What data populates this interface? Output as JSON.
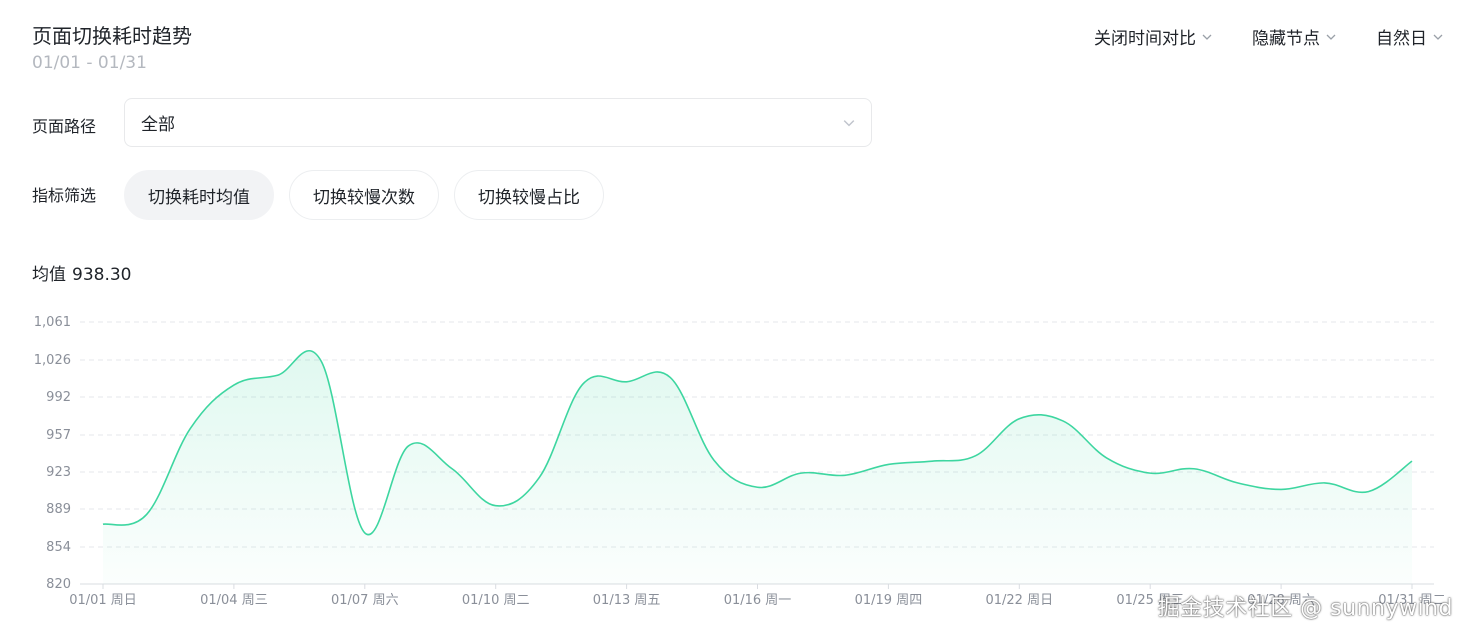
{
  "header": {
    "title": "页面切换耗时趋势",
    "date_range": "01/01 - 01/31",
    "controls": [
      {
        "label": "关闭时间对比"
      },
      {
        "label": "隐藏节点"
      },
      {
        "label": "自然日"
      }
    ]
  },
  "path": {
    "label": "页面路径",
    "value": "全部"
  },
  "metric": {
    "label": "指标筛选",
    "options": [
      {
        "label": "切换耗时均值",
        "active": true
      },
      {
        "label": "切换较慢次数",
        "active": false
      },
      {
        "label": "切换较慢占比",
        "active": false
      }
    ]
  },
  "summary": {
    "label": "均值",
    "value": "938.30"
  },
  "watermark": "掘金技术社区 @ sunnywind",
  "colors": {
    "line": "#3dd6a0",
    "grid": "#e5e7eb"
  },
  "chart_data": {
    "type": "area",
    "ylim": [
      820,
      1061
    ],
    "yticks": [
      "1,061",
      "1,026",
      "992",
      "957",
      "923",
      "889",
      "854",
      "820"
    ],
    "ytick_values": [
      1061,
      1026,
      992,
      957,
      923,
      889,
      854,
      820
    ],
    "xtick_labels": [
      {
        "day": 1,
        "label": "01/01 周日"
      },
      {
        "day": 4,
        "label": "01/04 周三"
      },
      {
        "day": 7,
        "label": "01/07 周六"
      },
      {
        "day": 10,
        "label": "01/10 周二"
      },
      {
        "day": 13,
        "label": "01/13 周五"
      },
      {
        "day": 16,
        "label": "01/16 周一"
      },
      {
        "day": 19,
        "label": "01/19 周四"
      },
      {
        "day": 22,
        "label": "01/22 周日"
      },
      {
        "day": 25,
        "label": "01/25 周三"
      },
      {
        "day": 28,
        "label": "01/28 周六"
      },
      {
        "day": 31,
        "label": "01/31 周二"
      }
    ],
    "x": [
      1,
      2,
      3,
      4,
      5,
      6,
      7,
      8,
      9,
      10,
      11,
      12,
      13,
      14,
      15,
      16,
      17,
      18,
      19,
      20,
      21,
      22,
      23,
      24,
      25,
      26,
      27,
      28,
      29,
      30,
      31
    ],
    "values": [
      875,
      884,
      963,
      1003,
      1012,
      1025,
      867,
      947,
      926,
      892,
      918,
      1004,
      1006,
      1010,
      934,
      909,
      922,
      920,
      930,
      933,
      938,
      972,
      970,
      936,
      922,
      926,
      913,
      907,
      913,
      905,
      933
    ],
    "grid": true,
    "legend": "none"
  }
}
